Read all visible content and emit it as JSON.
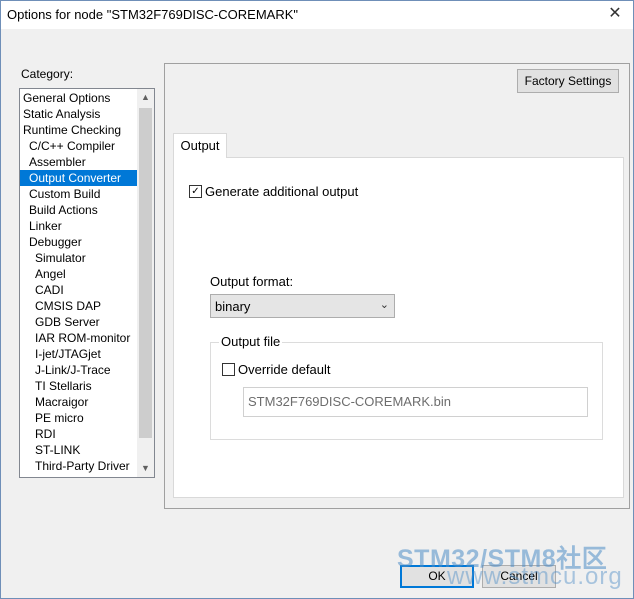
{
  "dialog": {
    "title": "Options for node \"STM32F769DISC-COREMARK\"",
    "close_glyph": "✕"
  },
  "category": {
    "label": "Category:",
    "items": [
      "General Options",
      "Static Analysis",
      "Runtime Checking",
      "C/C++ Compiler",
      "Assembler",
      "Output Converter",
      "Custom Build",
      "Build Actions",
      "Linker",
      "Debugger",
      "Simulator",
      "Angel",
      "CADI",
      "CMSIS DAP",
      "GDB Server",
      "IAR ROM-monitor",
      "I-jet/JTAGjet",
      "J-Link/J-Trace",
      "TI Stellaris",
      "Macraigor",
      "PE micro",
      "RDI",
      "ST-LINK",
      "Third-Party Driver"
    ],
    "selected": "Output Converter",
    "scroll_up": "▲",
    "scroll_down": "▼"
  },
  "panel": {
    "factory_settings": "Factory Settings",
    "tab": "Output",
    "generate_output": {
      "label": "Generate additional output",
      "checked": true,
      "mark": "✓"
    },
    "output_format": {
      "label": "Output format:",
      "value": "binary",
      "chevron": "⌄"
    },
    "output_file": {
      "group_label": "Output file",
      "override_default": {
        "label": "Override default",
        "checked": false
      },
      "path": "STM32F769DISC-COREMARK.bin"
    }
  },
  "buttons": {
    "ok": "OK",
    "cancel": "Cancel"
  },
  "watermark": {
    "line1": "STM32/STM8社区",
    "line2": "www.stmcu.org"
  },
  "colors": {
    "selection": "#0078d7",
    "watermark": "#4f8ec8"
  }
}
